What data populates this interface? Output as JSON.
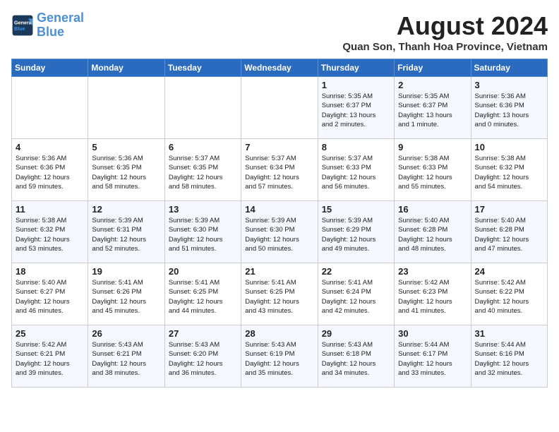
{
  "logo": {
    "line1": "General",
    "line2": "Blue"
  },
  "title": "August 2024",
  "subtitle": "Quan Son, Thanh Hoa Province, Vietnam",
  "days_of_week": [
    "Sunday",
    "Monday",
    "Tuesday",
    "Wednesday",
    "Thursday",
    "Friday",
    "Saturday"
  ],
  "weeks": [
    [
      {
        "day": "",
        "info": ""
      },
      {
        "day": "",
        "info": ""
      },
      {
        "day": "",
        "info": ""
      },
      {
        "day": "",
        "info": ""
      },
      {
        "day": "1",
        "info": "Sunrise: 5:35 AM\nSunset: 6:37 PM\nDaylight: 13 hours\nand 2 minutes."
      },
      {
        "day": "2",
        "info": "Sunrise: 5:35 AM\nSunset: 6:37 PM\nDaylight: 13 hours\nand 1 minute."
      },
      {
        "day": "3",
        "info": "Sunrise: 5:36 AM\nSunset: 6:36 PM\nDaylight: 13 hours\nand 0 minutes."
      }
    ],
    [
      {
        "day": "4",
        "info": "Sunrise: 5:36 AM\nSunset: 6:36 PM\nDaylight: 12 hours\nand 59 minutes."
      },
      {
        "day": "5",
        "info": "Sunrise: 5:36 AM\nSunset: 6:35 PM\nDaylight: 12 hours\nand 58 minutes."
      },
      {
        "day": "6",
        "info": "Sunrise: 5:37 AM\nSunset: 6:35 PM\nDaylight: 12 hours\nand 58 minutes."
      },
      {
        "day": "7",
        "info": "Sunrise: 5:37 AM\nSunset: 6:34 PM\nDaylight: 12 hours\nand 57 minutes."
      },
      {
        "day": "8",
        "info": "Sunrise: 5:37 AM\nSunset: 6:33 PM\nDaylight: 12 hours\nand 56 minutes."
      },
      {
        "day": "9",
        "info": "Sunrise: 5:38 AM\nSunset: 6:33 PM\nDaylight: 12 hours\nand 55 minutes."
      },
      {
        "day": "10",
        "info": "Sunrise: 5:38 AM\nSunset: 6:32 PM\nDaylight: 12 hours\nand 54 minutes."
      }
    ],
    [
      {
        "day": "11",
        "info": "Sunrise: 5:38 AM\nSunset: 6:32 PM\nDaylight: 12 hours\nand 53 minutes."
      },
      {
        "day": "12",
        "info": "Sunrise: 5:39 AM\nSunset: 6:31 PM\nDaylight: 12 hours\nand 52 minutes."
      },
      {
        "day": "13",
        "info": "Sunrise: 5:39 AM\nSunset: 6:30 PM\nDaylight: 12 hours\nand 51 minutes."
      },
      {
        "day": "14",
        "info": "Sunrise: 5:39 AM\nSunset: 6:30 PM\nDaylight: 12 hours\nand 50 minutes."
      },
      {
        "day": "15",
        "info": "Sunrise: 5:39 AM\nSunset: 6:29 PM\nDaylight: 12 hours\nand 49 minutes."
      },
      {
        "day": "16",
        "info": "Sunrise: 5:40 AM\nSunset: 6:28 PM\nDaylight: 12 hours\nand 48 minutes."
      },
      {
        "day": "17",
        "info": "Sunrise: 5:40 AM\nSunset: 6:28 PM\nDaylight: 12 hours\nand 47 minutes."
      }
    ],
    [
      {
        "day": "18",
        "info": "Sunrise: 5:40 AM\nSunset: 6:27 PM\nDaylight: 12 hours\nand 46 minutes."
      },
      {
        "day": "19",
        "info": "Sunrise: 5:41 AM\nSunset: 6:26 PM\nDaylight: 12 hours\nand 45 minutes."
      },
      {
        "day": "20",
        "info": "Sunrise: 5:41 AM\nSunset: 6:25 PM\nDaylight: 12 hours\nand 44 minutes."
      },
      {
        "day": "21",
        "info": "Sunrise: 5:41 AM\nSunset: 6:25 PM\nDaylight: 12 hours\nand 43 minutes."
      },
      {
        "day": "22",
        "info": "Sunrise: 5:41 AM\nSunset: 6:24 PM\nDaylight: 12 hours\nand 42 minutes."
      },
      {
        "day": "23",
        "info": "Sunrise: 5:42 AM\nSunset: 6:23 PM\nDaylight: 12 hours\nand 41 minutes."
      },
      {
        "day": "24",
        "info": "Sunrise: 5:42 AM\nSunset: 6:22 PM\nDaylight: 12 hours\nand 40 minutes."
      }
    ],
    [
      {
        "day": "25",
        "info": "Sunrise: 5:42 AM\nSunset: 6:21 PM\nDaylight: 12 hours\nand 39 minutes."
      },
      {
        "day": "26",
        "info": "Sunrise: 5:43 AM\nSunset: 6:21 PM\nDaylight: 12 hours\nand 38 minutes."
      },
      {
        "day": "27",
        "info": "Sunrise: 5:43 AM\nSunset: 6:20 PM\nDaylight: 12 hours\nand 36 minutes."
      },
      {
        "day": "28",
        "info": "Sunrise: 5:43 AM\nSunset: 6:19 PM\nDaylight: 12 hours\nand 35 minutes."
      },
      {
        "day": "29",
        "info": "Sunrise: 5:43 AM\nSunset: 6:18 PM\nDaylight: 12 hours\nand 34 minutes."
      },
      {
        "day": "30",
        "info": "Sunrise: 5:44 AM\nSunset: 6:17 PM\nDaylight: 12 hours\nand 33 minutes."
      },
      {
        "day": "31",
        "info": "Sunrise: 5:44 AM\nSunset: 6:16 PM\nDaylight: 12 hours\nand 32 minutes."
      }
    ]
  ]
}
